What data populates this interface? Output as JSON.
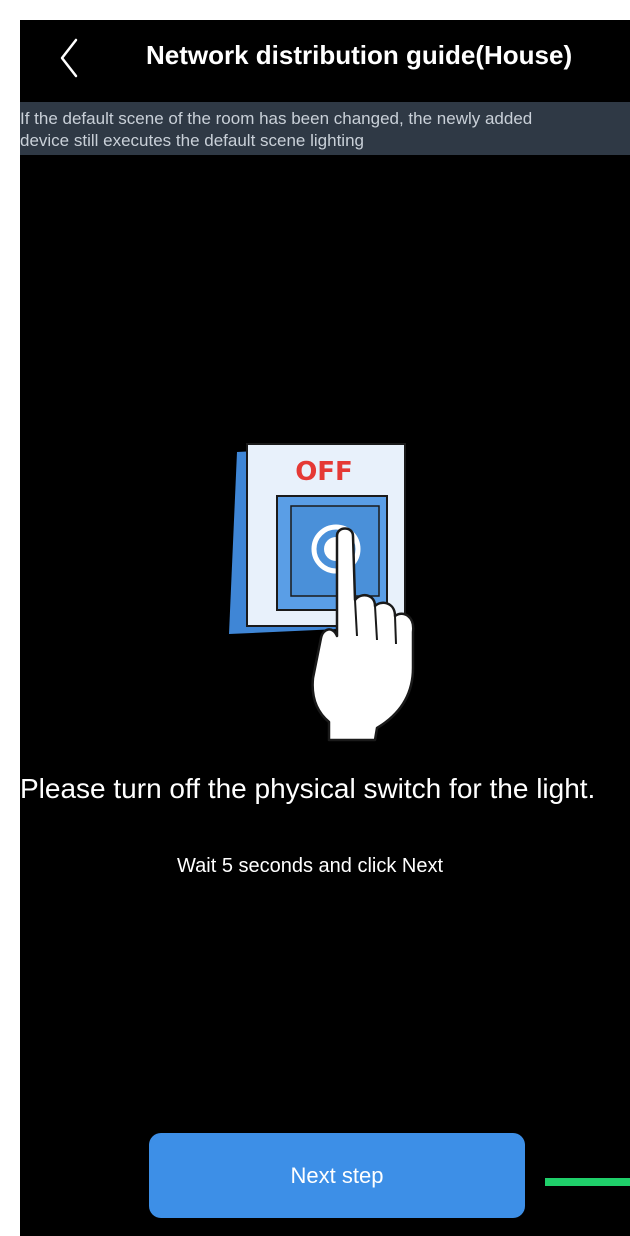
{
  "header": {
    "back_icon": "chevron-left-icon",
    "title": "Network distribution guide(House)"
  },
  "notice": {
    "line1": "If the default scene of the room has been changed, the newly added",
    "line2": "device still executes the default scene lighting"
  },
  "illustration": {
    "switch_label": "OFF",
    "icon": "light-switch-hand-icon",
    "colors": {
      "label_red": "#e53935",
      "switch_blue": "#4a90d9",
      "plate": "#e8f1fb"
    }
  },
  "instruction": {
    "main": "Please turn off the physical switch for the light.",
    "sub": "Wait 5 seconds and click Next"
  },
  "footer": {
    "next_label": "Next step"
  },
  "colors": {
    "background": "#000000",
    "notice_bg": "#2f3945",
    "primary_button": "#3d8fe7",
    "indicator_green": "#1fcf6a"
  }
}
